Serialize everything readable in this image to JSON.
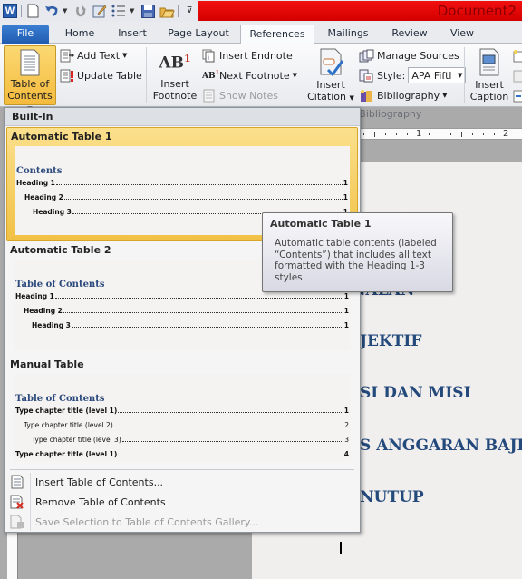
{
  "window": {
    "title": "Document2",
    "accent_color": "#e00000"
  },
  "quick_access": {
    "items": [
      "word-logo",
      "new-document-icon",
      "undo-icon",
      "redo-icon",
      "edit-icon",
      "bullets-icon",
      "save-icon",
      "open-icon",
      "customize-qat-icon"
    ],
    "logo_letter": "W"
  },
  "tabs": [
    {
      "label": "File",
      "active": false
    },
    {
      "label": "Home",
      "active": false
    },
    {
      "label": "Insert",
      "active": false
    },
    {
      "label": "Page Layout",
      "active": false
    },
    {
      "label": "References",
      "active": true
    },
    {
      "label": "Mailings",
      "active": false
    },
    {
      "label": "Review",
      "active": false
    },
    {
      "label": "View",
      "active": false
    }
  ],
  "ribbon": {
    "toc": {
      "label_line1": "Table of",
      "label_line2": "Contents"
    },
    "add_text": "Add Text",
    "update_table": "Update Table",
    "insert_footnote": {
      "line1": "Insert",
      "line2": "Footnote"
    },
    "insert_endnote": "Insert Endnote",
    "next_footnote": "Next Footnote",
    "show_notes": "Show Notes",
    "insert_citation": {
      "line1": "Insert",
      "line2": "Citation"
    },
    "manage_sources": "Manage Sources",
    "style_label": "Style:",
    "style_value": "APA Fiftl",
    "bibliography": "Bibliography",
    "group_citations": "ns & Bibliography",
    "insert_caption": {
      "line1": "Insert",
      "line2": "Caption"
    }
  },
  "ruler": {
    "labels": [
      "1",
      "2"
    ]
  },
  "menu": {
    "header": "Built-In",
    "gallery": [
      {
        "title": "Automatic Table 1",
        "preview_title": "Contents",
        "lines": [
          {
            "text": "Heading 1",
            "page": "1",
            "level": 1
          },
          {
            "text": "Heading 2",
            "page": "1",
            "level": 2
          },
          {
            "text": "Heading 3",
            "page": "1",
            "level": 3
          }
        ]
      },
      {
        "title": "Automatic Table 2",
        "preview_title": "Table of Contents",
        "lines": [
          {
            "text": "Heading 1",
            "page": "1",
            "level": 1
          },
          {
            "text": "Heading 2",
            "page": "1",
            "level": 2
          },
          {
            "text": "Heading 3",
            "page": "1",
            "level": 3
          }
        ]
      },
      {
        "title": "Manual Table",
        "preview_title": "Table of Contents",
        "lines": [
          {
            "text": "Type chapter title (level 1)",
            "page": "1",
            "level": 1
          },
          {
            "text": "Type chapter title (level 2)",
            "page": "2",
            "level": 2
          },
          {
            "text": "Type chapter title (level 3)",
            "page": "3",
            "level": 3
          },
          {
            "text": "Type chapter title (level 1)",
            "page": "4",
            "level": 1
          }
        ]
      }
    ],
    "commands": [
      {
        "label": "Insert Table of Contents...",
        "enabled": true
      },
      {
        "label": "Remove Table of Contents",
        "enabled": true
      },
      {
        "label": "Save Selection to Table of Contents Gallery...",
        "enabled": false
      }
    ]
  },
  "tooltip": {
    "title": "Automatic Table 1",
    "body": "Automatic table contents (labeled “Contents”) that includes all text formatted with the Heading 1-3 styles"
  },
  "document": {
    "headings": [
      "NGENALAN",
      "JEKTIF",
      "SI DAN MISI",
      "S ANGGARAN BAJET",
      "NUTUP"
    ],
    "heading_color": "#244a7c"
  }
}
